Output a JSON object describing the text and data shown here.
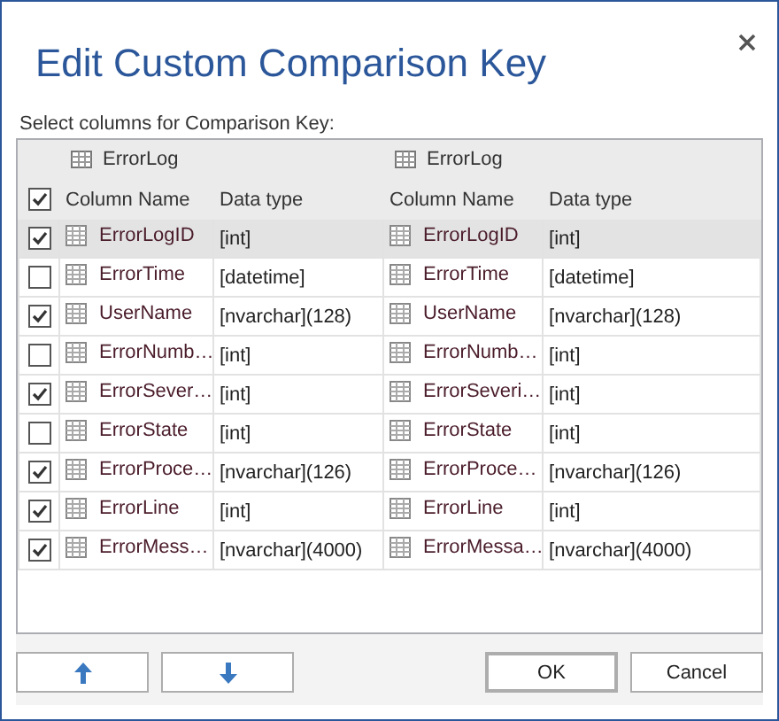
{
  "window": {
    "title": "Edit Custom Comparison Key"
  },
  "instruction": "Select columns for Comparison Key:",
  "grid": {
    "tables": [
      "ErrorLog",
      "ErrorLog"
    ],
    "select_all_checked": true,
    "columns": [
      "Column Name",
      "Data type",
      "Column Name",
      "Data type"
    ],
    "rows": [
      {
        "checked": true,
        "selected": true,
        "left_name": "ErrorLogID",
        "left_type": "[int]",
        "right_name": "ErrorLogID",
        "right_type": "[int]"
      },
      {
        "checked": false,
        "selected": false,
        "left_name": "ErrorTime",
        "left_type": "[datetime]",
        "right_name": "ErrorTime",
        "right_type": "[datetime]"
      },
      {
        "checked": true,
        "selected": false,
        "left_name": "UserName",
        "left_type": "[nvarchar](128)",
        "right_name": "UserName",
        "right_type": "[nvarchar](128)"
      },
      {
        "checked": false,
        "selected": false,
        "left_name": "ErrorNumb…",
        "left_type": "[int]",
        "right_name": "ErrorNumb…",
        "right_type": "[int]"
      },
      {
        "checked": true,
        "selected": false,
        "left_name": "ErrorSever…",
        "left_type": "[int]",
        "right_name": "ErrorSeveri…",
        "right_type": "[int]"
      },
      {
        "checked": false,
        "selected": false,
        "left_name": "ErrorState",
        "left_type": "[int]",
        "right_name": "ErrorState",
        "right_type": "[int]"
      },
      {
        "checked": true,
        "selected": false,
        "left_name": "ErrorProce…",
        "left_type": "[nvarchar](126)",
        "right_name": "ErrorProce…",
        "right_type": "[nvarchar](126)"
      },
      {
        "checked": true,
        "selected": false,
        "left_name": "ErrorLine",
        "left_type": "[int]",
        "right_name": "ErrorLine",
        "right_type": "[int]"
      },
      {
        "checked": true,
        "selected": false,
        "left_name": "ErrorMess…",
        "left_type": "[nvarchar](4000)",
        "right_name": "ErrorMessa…",
        "right_type": "[nvarchar](4000)"
      }
    ]
  },
  "buttons": [
    {
      "kind": "up"
    },
    {
      "kind": "down"
    },
    {
      "kind": "text",
      "label": "OK",
      "default": true
    },
    {
      "kind": "text",
      "label": "Cancel",
      "default": false
    }
  ]
}
